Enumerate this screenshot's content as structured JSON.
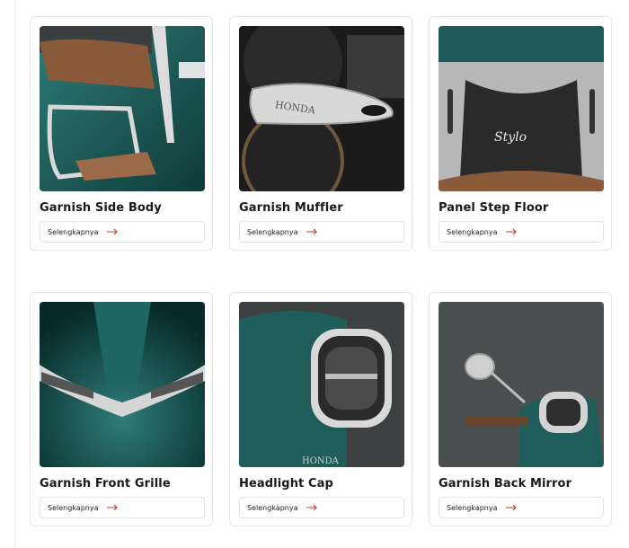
{
  "cards": [
    {
      "title": "Garnish Side Body",
      "button_label": "Selengkapnya",
      "image_icon": "garnish-side-body-image"
    },
    {
      "title": "Garnish Muffler",
      "button_label": "Selengkapnya",
      "image_icon": "garnish-muffler-image",
      "image_text": "HONDA"
    },
    {
      "title": "Panel Step Floor",
      "button_label": "Selengkapnya",
      "image_icon": "panel-step-floor-image",
      "image_text": "Stylo"
    },
    {
      "title": "Garnish Front Grille",
      "button_label": "Selengkapnya",
      "image_icon": "garnish-front-grille-image"
    },
    {
      "title": "Headlight Cap",
      "button_label": "Selengkapnya",
      "image_icon": "headlight-cap-image",
      "image_text": "HONDA"
    },
    {
      "title": "Garnish Back Mirror",
      "button_label": "Selengkapnya",
      "image_icon": "garnish-back-mirror-image"
    }
  ],
  "colors": {
    "accent_arrow": "#c0392b",
    "body_teal": "#1d5b58",
    "seat_brown": "#8a5a3b"
  }
}
